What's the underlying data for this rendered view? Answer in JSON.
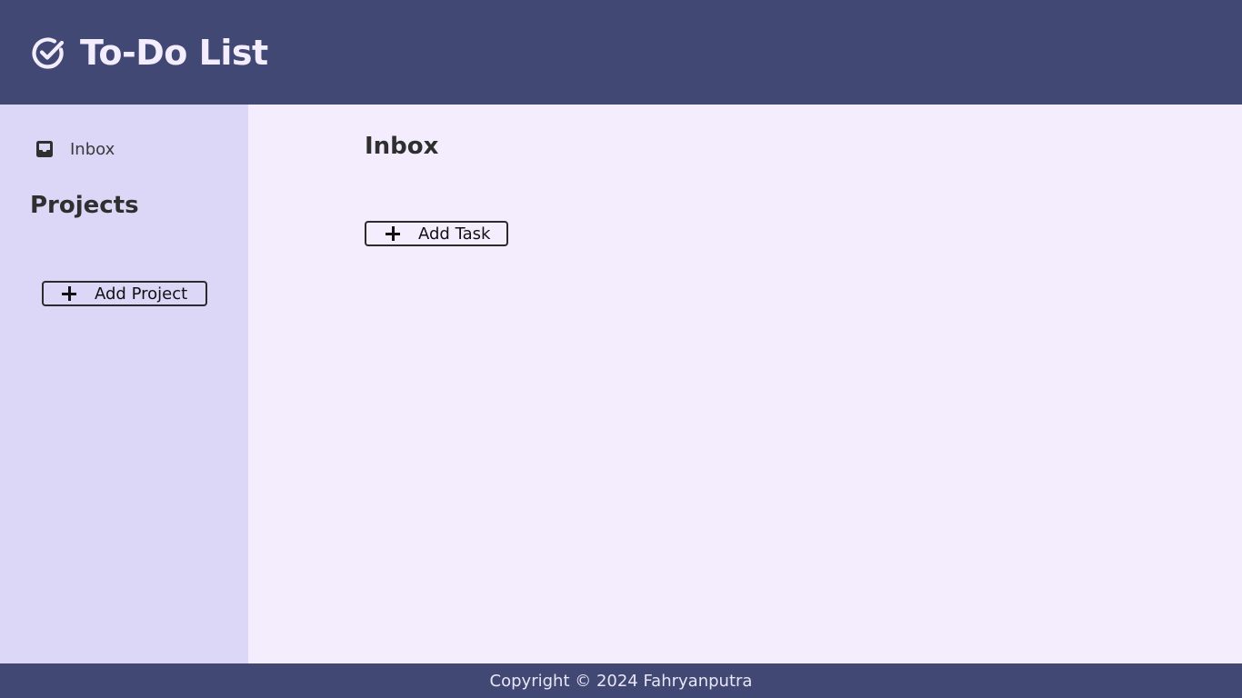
{
  "header": {
    "title": "To-Do List",
    "logo_icon": "check-circle-icon"
  },
  "sidebar": {
    "inbox": {
      "label": "Inbox",
      "icon": "inbox-icon"
    },
    "projects_heading": "Projects",
    "add_project_label": "Add Project"
  },
  "main": {
    "title": "Inbox",
    "add_task_label": "Add Task"
  },
  "footer": {
    "text": "Copyright © 2024 Fahryanputra"
  },
  "colors": {
    "header_bg": "#414873",
    "sidebar_bg": "#dcd6f7",
    "main_bg": "#f3edfd",
    "footer_bg": "#414873"
  }
}
